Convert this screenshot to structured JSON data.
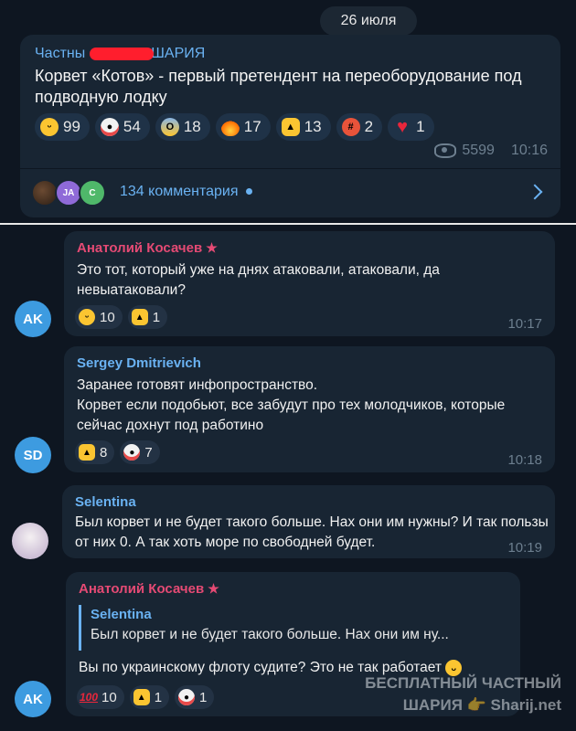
{
  "date": "26 июля",
  "post": {
    "channel": "Частны",
    "channel_tail": "ШАРИЯ",
    "text": "Корвет «Котов» - первый претендент на переоборудование под подводную лодку",
    "reactions": [
      {
        "icon": "grin-emoji",
        "count": "99"
      },
      {
        "icon": "clown-emoji",
        "count": "54"
      },
      {
        "icon": "scream-emoji",
        "count": "18"
      },
      {
        "icon": "fire-emoji",
        "count": "17"
      },
      {
        "icon": "thumbs-up-emoji",
        "count": "13"
      },
      {
        "icon": "cursing-emoji",
        "count": "2"
      },
      {
        "icon": "heart-emoji",
        "count": "1"
      }
    ],
    "views": "5599",
    "time": "10:16",
    "comments_label": "134 комментария",
    "commenter_initials": [
      "JA",
      "C"
    ]
  },
  "comments": [
    {
      "author": "Анатолий Косачев",
      "author_color": "#e54a74",
      "text": "Это тот, который уже на днях атаковали, атаковали, да невыатаковали?",
      "reactions": [
        {
          "icon": "grin-emoji",
          "count": "10"
        },
        {
          "icon": "thumbs-up-emoji",
          "count": "1"
        }
      ],
      "time": "10:17",
      "avatar": "AK"
    },
    {
      "author": "Sergey Dmitrievich",
      "author_color": "#6ab2f2",
      "text": "Заранее готовят инфопространство.\nКорвет если подобьют, все забудут про тех молодчиков, которые сейчас дохнут под работино",
      "reactions": [
        {
          "icon": "thumbs-up-emoji",
          "count": "8"
        },
        {
          "icon": "clown-emoji",
          "count": "7"
        }
      ],
      "time": "10:18",
      "avatar": "SD"
    },
    {
      "author": "Selentina",
      "author_color": "#6ab2f2",
      "text": "Был корвет и не будет такого больше. Нах они им нужны? И так пользы от них 0. А так хоть море по свободней будет.",
      "time": "10:19"
    },
    {
      "author": "Анатолий Косачев",
      "author_color": "#e54a74",
      "reply_name": "Selentina",
      "reply_text": "Был корвет и не будет такого больше. Нах они им ну...",
      "text": "Вы по украинскому флоту судите? Это не так работает",
      "reactions": [
        {
          "icon": "100-emoji",
          "count": "10"
        },
        {
          "icon": "thumbs-up-emoji",
          "count": "1"
        },
        {
          "icon": "clown-emoji",
          "count": "1"
        }
      ],
      "avatar": "AK"
    }
  ],
  "watermark": {
    "line1": "БЕСПЛАТНЫЙ ЧАСТНЫЙ",
    "line2": "ШАРИЯ 👉 Sharij.net"
  }
}
